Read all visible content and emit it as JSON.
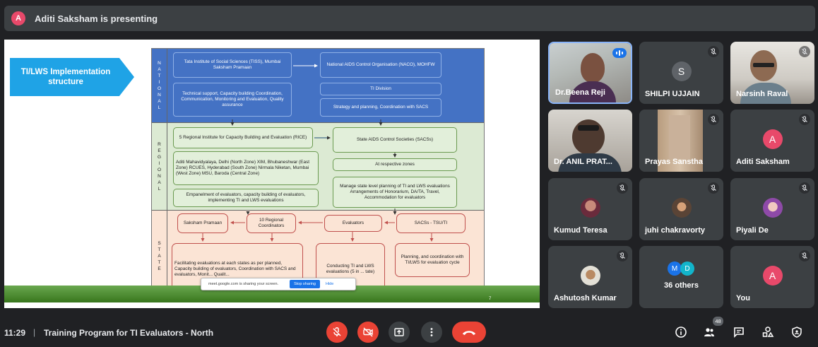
{
  "presenter": {
    "initial": "A",
    "text": "Aditi Saksham is presenting"
  },
  "slide": {
    "title_arrow": "TI/LWS Implementation structure",
    "page_number": "7",
    "bands": {
      "national_label": [
        "N",
        "A",
        "T",
        "I",
        "O",
        "N",
        "A",
        "L"
      ],
      "regional_label": [
        "R",
        "E",
        "G",
        "I",
        "O",
        "N",
        "A",
        "L"
      ],
      "state_label": [
        "S",
        "T",
        "A",
        "T",
        "E"
      ]
    },
    "boxes": {
      "tiss": "Tata Institute of Social Sciences (TISS), Mumbai Saksham Pramaan",
      "naco": "National AIDS Control Organisation (NACO), MOHFW",
      "tech_support": "Technical support, Capacity building Coordination, Communication, Monitoring and Evaluation, Quality assurance",
      "ti_division": "TI Division",
      "strategy": "Strategy and planning, Coordination with SACS",
      "rice": "5 Regional Institute for Capacity Building and Evaluation (RICE)",
      "sacs": "State AIDS Control Societies (SACSs)",
      "zones": "Aditi Mahavidyalaya, Delhi (North Zone) XIM, Bhubaneshwar (East Zone) RCUES, Hyderabad (South Zone) Nirmala Niketan, Mumbai (West Zone) MSU, Baroda (Central Zone)",
      "respective_zones": "At respective zones",
      "empanelment": "Empanelment of evaluators, capacity building of evaluators, implementing TI and LWS evaluations",
      "manage_state": "Manage state level planning of TI and LWS evaluations Arrangements of Honorarium, DA/TA, Travel, Accommodation for evaluators",
      "saksham_pramaan": "Saksham Pramaan",
      "regional_coordinators": "10 Regional Coordinators",
      "evaluators": "Evaluators",
      "sacs_tsu": "SACSs - TSU/TI",
      "facilitating": "Facilitating evaluations at each states as per planned, Capacity building of evaluators, Coordination with SACS and evaluators, Monit... Qualit...",
      "conducting": "Conducting TI and LWS evaluations (5 in ... tate)",
      "planning": "Planning, and coordination with TI/LWS for evaluation cycle"
    },
    "share_popup": {
      "text": "meet.google.com is sharing your screen.",
      "stop": "Stop sharing",
      "hide": "Hide"
    }
  },
  "participants": [
    {
      "name": "Dr.Beena Reji",
      "type": "photo",
      "speaking": true
    },
    {
      "name": "SHILPI UJJAIN",
      "type": "avatar",
      "initial": "S",
      "avatar_color": "#5f6368",
      "muted": true
    },
    {
      "name": "Narsinh Raval",
      "type": "photo",
      "muted": true
    },
    {
      "name": "Dr. ANIL PRAT...",
      "type": "photo"
    },
    {
      "name": "Prayas Sanstha",
      "type": "photo",
      "muted": true
    },
    {
      "name": "Aditi Saksham",
      "type": "avatar",
      "initial": "A",
      "avatar_color": "#e8496a",
      "muted": true
    },
    {
      "name": "Kumud Teresa",
      "type": "small-photo",
      "muted": true
    },
    {
      "name": "juhi chakravorty",
      "type": "small-photo",
      "muted": true
    },
    {
      "name": "Piyali De",
      "type": "small-photo",
      "muted": true
    },
    {
      "name": "Ashutosh Kumar",
      "type": "small-photo",
      "muted": true
    },
    {
      "name": "36 others",
      "type": "others",
      "initials": [
        "M",
        "D"
      ]
    },
    {
      "name": "You",
      "type": "avatar",
      "initial": "A",
      "avatar_color": "#e8496a",
      "muted": true
    }
  ],
  "bottom_bar": {
    "time": "11:29",
    "separator": "|",
    "title": "Training Program for TI Evaluators - North",
    "participant_count": "48",
    "icons": [
      "mic-off-icon",
      "camera-off-icon",
      "present-icon",
      "more-icon",
      "hangup-icon",
      "info-icon",
      "people-icon",
      "chat-icon",
      "activities-icon",
      "host-controls-icon"
    ],
    "colors": {
      "red": "#ea4335",
      "gray": "#3c4043",
      "bg": "#202124"
    }
  }
}
